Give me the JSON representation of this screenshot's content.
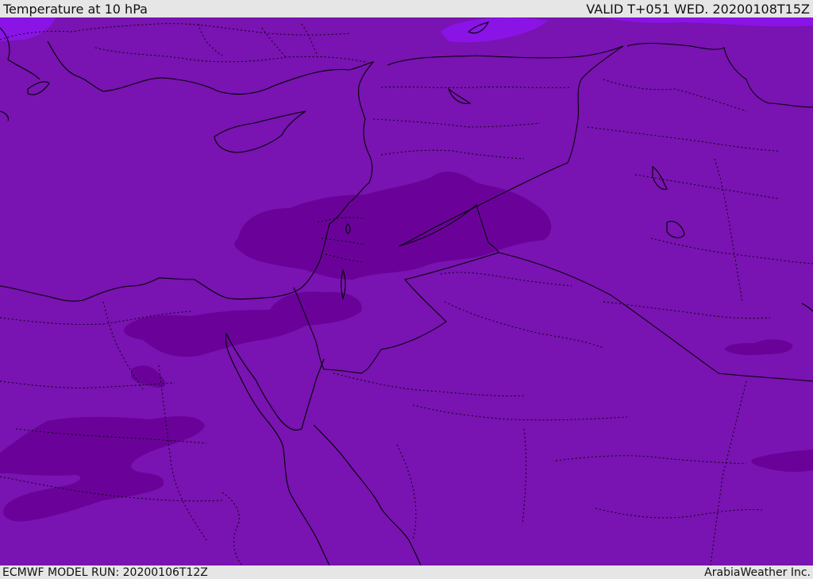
{
  "header": {
    "title": "Temperature at 10 hPa",
    "valid": "VALID T+051 WED. 20200108T15Z"
  },
  "footer": {
    "model_run": "ECMWF MODEL RUN: 20200106T12Z",
    "credit": "ArabiaWeather Inc."
  },
  "colors": {
    "base_fill": "#7913b1",
    "cold_core": "#6a0299",
    "warm_patch": "#8a14e6",
    "coastline": "#000000",
    "border": "#000000"
  }
}
